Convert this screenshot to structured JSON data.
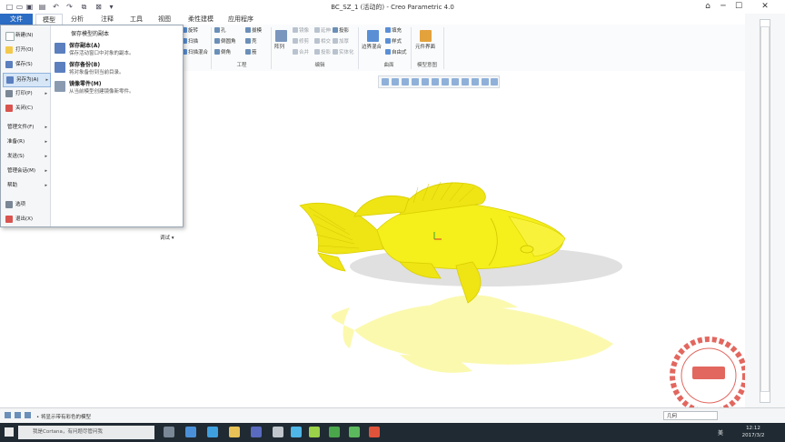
{
  "window": {
    "title": "BC_SZ_1 (活动的) - Creo Parametric 4.0",
    "minimize": "─",
    "maximize": "☐",
    "close": "✕"
  },
  "ribbon_tabs": [
    "文件",
    "模型",
    "分析",
    "注释",
    "工具",
    "视图",
    "柔性建模",
    "应用程序"
  ],
  "ribbon": {
    "shapes_col1": [
      "旋转",
      "扫描",
      "扫描混合"
    ],
    "engineering_col1": [
      "孔",
      "倒圆角",
      "倒角"
    ],
    "engineering_col2": [
      "拔模",
      "壳",
      "筋"
    ],
    "engineering_label": "工程",
    "editing_big": "阵列",
    "editing_col1": [
      "镜像",
      "修剪",
      "合并"
    ],
    "editing_col2": [
      "延伸",
      "相交",
      "投影"
    ],
    "editing_col3": [
      "投影",
      "加厚",
      "实体化"
    ],
    "editing_label": "编辑",
    "surface_big": "边界混合",
    "surface_col": [
      "填充",
      "样式",
      "自由式"
    ],
    "surface_label": "曲面",
    "intent_big": "元件界面",
    "intent_label": "模型意图"
  },
  "file_menu": {
    "items": [
      {
        "label": "新建(N)",
        "icon": "new-file-icon",
        "color": "#ffffff"
      },
      {
        "label": "打开(O)",
        "icon": "open-folder-icon",
        "color": "#f2c94c"
      },
      {
        "label": "保存(S)",
        "icon": "save-disk-icon",
        "color": "#5b7fbf"
      },
      {
        "label": "另存为(A)",
        "icon": "save-as-icon",
        "color": "#5b7fbf"
      },
      {
        "label": "打印(P)",
        "icon": "printer-icon",
        "color": "#7a8796"
      },
      {
        "label": "关闭(C)",
        "icon": "close-window-icon",
        "color": "#d9534f"
      },
      {
        "label": "管理文件(F)",
        "icon": "",
        "color": ""
      },
      {
        "label": "准备(R)",
        "icon": "",
        "color": ""
      },
      {
        "label": "发送(S)",
        "icon": "",
        "color": ""
      },
      {
        "label": "管理会话(M)",
        "icon": "",
        "color": ""
      },
      {
        "label": "帮助",
        "icon": "",
        "color": ""
      },
      {
        "label": "选项",
        "icon": "options-icon",
        "color": "#7a8796"
      },
      {
        "label": "退出(X)",
        "icon": "exit-icon",
        "color": "#d9534f"
      }
    ],
    "submenu_title": "保存模型的副本",
    "submenu": [
      {
        "title": "保存副本(A)",
        "desc": "保存活动窗口中对象的副本。"
      },
      {
        "title": "保存备份(B)",
        "desc": "将对象备份到当前目录。"
      },
      {
        "title": "镜像零件(M)",
        "desc": "从当前模型创建镜像新零件。"
      }
    ],
    "debug_label": "调试 ▾"
  },
  "status": {
    "message": "• 将显示带有彩色的模型",
    "filter": "几何"
  },
  "taskbar": {
    "search_placeholder": "我是Cortana，有问题尽管问我",
    "ime": "美",
    "time": "12:12",
    "date": "2017/3/2"
  },
  "watermark": {
    "text": "BOCHUANG SHEJIFANG",
    "center": "博创",
    "bottom": "设计坊"
  },
  "colors": {
    "accent": "#2b6cc4",
    "model": "#f5ef1b",
    "watermark": "#e2675f"
  }
}
